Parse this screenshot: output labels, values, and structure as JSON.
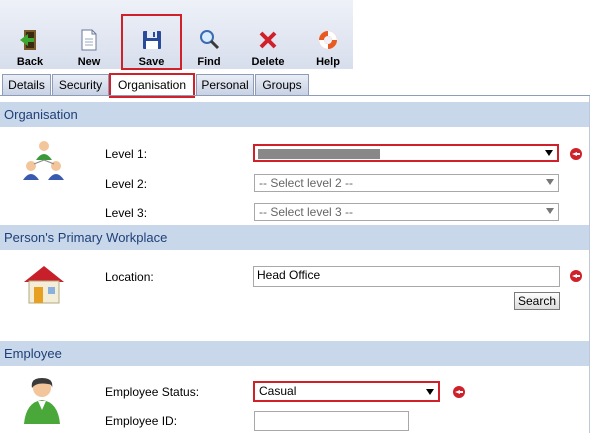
{
  "toolbar": {
    "back": "Back",
    "new": "New",
    "save": "Save",
    "find": "Find",
    "delete": "Delete",
    "help": "Help"
  },
  "tabs": [
    "Details",
    "Security",
    "Organisation",
    "Personal",
    "Groups"
  ],
  "organisation": {
    "header": "Organisation",
    "level1_label": "Level 1:",
    "level2_label": "Level 2:",
    "level2_value": "-- Select level 2 --",
    "level3_label": "Level 3:",
    "level3_value": "-- Select level 3 --"
  },
  "workplace": {
    "header": "Person's Primary Workplace",
    "location_label": "Location:",
    "location_value": "Head Office",
    "search_label": "Search"
  },
  "employee": {
    "header": "Employee",
    "status_label": "Employee Status:",
    "status_value": "Casual",
    "id_label": "Employee ID:",
    "id_value": ""
  }
}
